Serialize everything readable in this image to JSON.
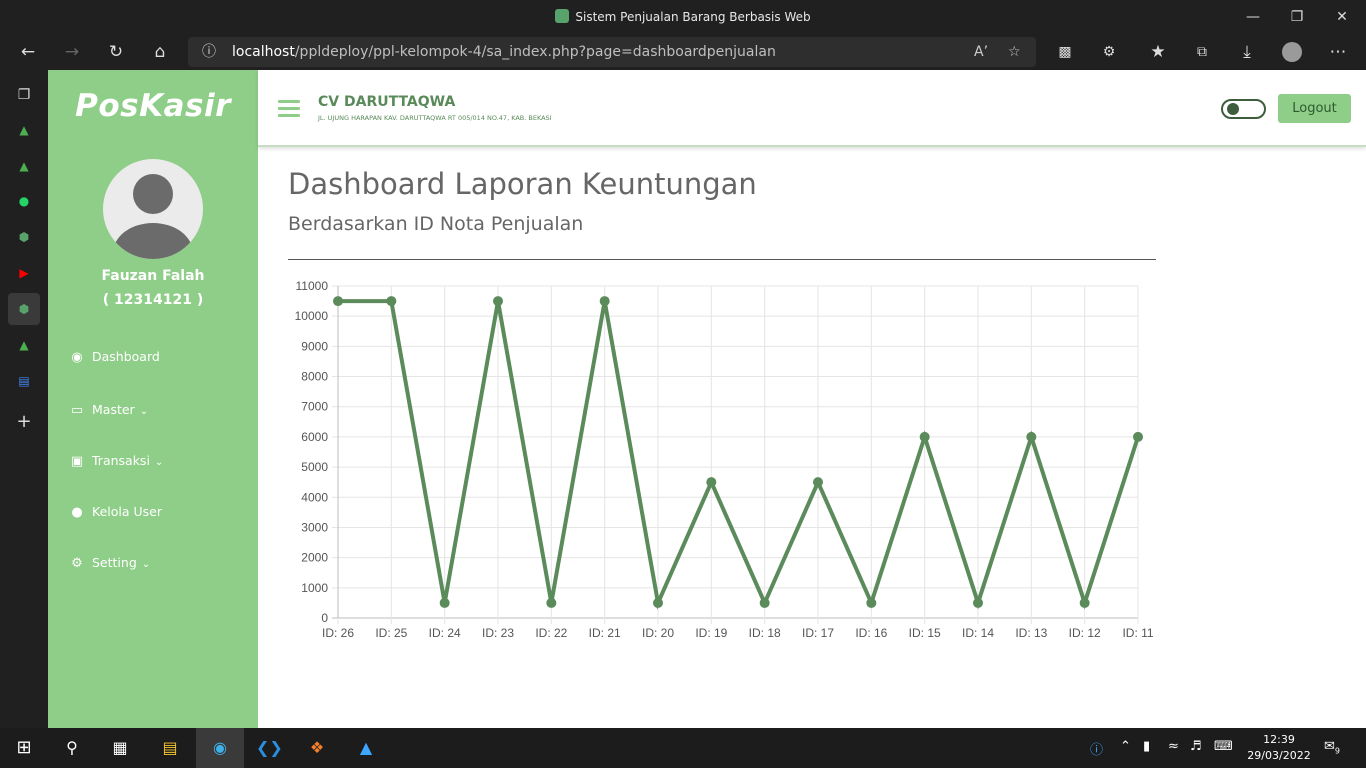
{
  "browser": {
    "window_title": "Sistem Penjualan Barang Berbasis Web",
    "url_host": "localhost",
    "url_path": "/ppldeploy/ppl-kelompok-4/sa_index.php?page=dashboardpenjualan"
  },
  "sidebar": {
    "brand": "PosKasir",
    "user_name": "Fauzan Falah",
    "user_id": "( 12314121 )",
    "items": [
      {
        "label": "Dashboard",
        "icon": "tachometer-icon"
      },
      {
        "label": "Master",
        "icon": "desktop-icon"
      },
      {
        "label": "Transaksi",
        "icon": "money-icon"
      },
      {
        "label": "Kelola User",
        "icon": "user-icon"
      },
      {
        "label": "Setting",
        "icon": "gear-icon"
      }
    ]
  },
  "header": {
    "company": "CV DARUTTAQWA",
    "address": "JL. UJUNG HARAPAN KAV. DARUTTAQWA RT 005/014 NO.47, KAB. BEKASI",
    "logout_label": "Logout"
  },
  "page": {
    "title": "Dashboard Laporan Keuntungan",
    "subtitle": "Berdasarkan ID Nota Penjualan"
  },
  "chart_data": {
    "type": "line",
    "categories": [
      "ID: 26",
      "ID: 25",
      "ID: 24",
      "ID: 23",
      "ID: 22",
      "ID: 21",
      "ID: 20",
      "ID: 19",
      "ID: 18",
      "ID: 17",
      "ID: 16",
      "ID: 15",
      "ID: 14",
      "ID: 13",
      "ID: 12",
      "ID: 11"
    ],
    "values": [
      10500,
      10500,
      500,
      10500,
      500,
      10500,
      500,
      4500,
      500,
      4500,
      500,
      6000,
      500,
      6000,
      500,
      6000
    ],
    "ylim": [
      0,
      11000
    ],
    "yticks": [
      0,
      1000,
      2000,
      3000,
      4000,
      5000,
      6000,
      7000,
      8000,
      9000,
      10000,
      11000
    ],
    "grid": true,
    "color": "#5b8a5b"
  },
  "taskbar": {
    "time": "12:39",
    "date": "29/03/2022",
    "notifications": "9"
  }
}
